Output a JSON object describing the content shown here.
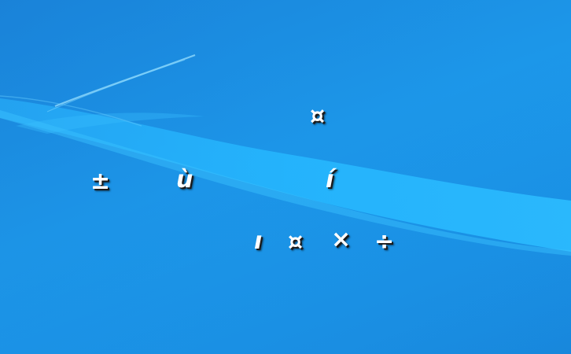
{
  "desktop": {
    "colors": {
      "background_dark": "#1887dc",
      "background_light": "#1c98ea",
      "wave": "#22b4ff",
      "glyph_text": "#ffffff",
      "glyph_shadow": "#1a1a1a"
    },
    "icons": [
      {
        "id": "g1",
        "label": "±"
      },
      {
        "id": "g2",
        "label": "ù"
      },
      {
        "id": "g3",
        "label": "¤"
      },
      {
        "id": "g4",
        "label": "í"
      },
      {
        "id": "g5",
        "label": "ı"
      },
      {
        "id": "g6",
        "label": "¤"
      },
      {
        "id": "g7",
        "label": "×"
      },
      {
        "id": "g8",
        "label": "÷"
      }
    ]
  }
}
